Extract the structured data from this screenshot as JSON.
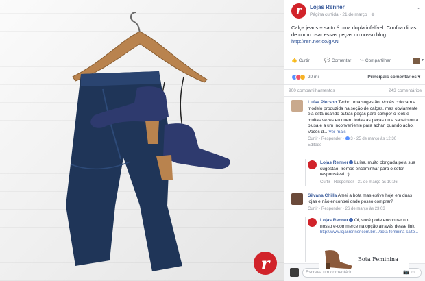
{
  "colors": {
    "brand": "#d1232a",
    "link": "#365899",
    "denim": "#1f3558",
    "boot": "#2e3a6e",
    "wood": "#b9834e"
  },
  "photo": {
    "brand_letter": "r"
  },
  "post": {
    "page_name": "Lojas Renner",
    "meta": "Página curtida · 21 de março · ",
    "text": "Calça jeans + salto é uma dupla infalível. Confira dicas de como usar essas peças no nosso blog:",
    "link": "http://ren.ner.co/gXN",
    "actions": {
      "like": "Curtir",
      "comment": "Comentar",
      "share": "Compartilhar"
    },
    "reactions_count": "20 mil",
    "sort_label": "Principais comentários",
    "shares": "900 compartilhamentos",
    "comments_count": "243 comentários"
  },
  "comments": [
    {
      "author": "Luísa Pierson",
      "text": "Tenho uma sugestão! Vocês colocam a modelo produzida na seção de calças, mas obviamente ela está usando outras peças para compor o look e muitas vezes eu quero todas as peças ou a sapato ou a blusa e a um inconveniente para achar, quando acho. Vocês d...",
      "see_more": "Ver mais",
      "meta_reply": "Curtir · Responder · ",
      "likes": "3",
      "time": " · 25 de março às 12:30 ·",
      "edited": "Editado"
    },
    {
      "author": "Lojas Renner",
      "text": "Luísa, muito obrigada pela sua sugestão. Iremos encaminhar para o setor responsável. :)",
      "meta": "Curtir · Responder · 31 de março às 10:26"
    },
    {
      "author": "Silvana Chilla",
      "text": "Amei a bota mas estive hoje em duas lojas e não encontrei onde posso comprar?",
      "meta": "Curtir · Responder · 26 de março às 23:03"
    },
    {
      "author": "Lojas Renner",
      "text": "Oi, você pode encontrar no nosso e-commerce na opção através desse link:",
      "link": "http://www.lojasrenner.com.br/.../bota-feminina-salto..."
    }
  ],
  "preview": {
    "title": "Bota Feminina"
  },
  "composer": {
    "placeholder": "Escreva um comentário"
  }
}
